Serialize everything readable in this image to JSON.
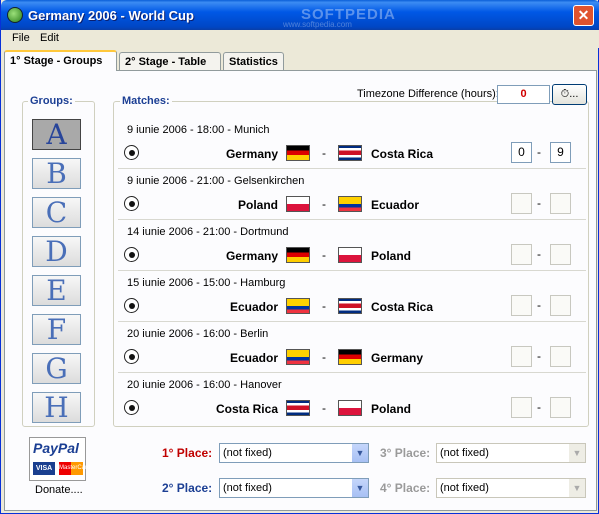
{
  "window": {
    "title": "Germany 2006 - World Cup",
    "watermark": "SOFTPEDIA",
    "watermark_url": "www.softpedia.com",
    "close_glyph": "✕"
  },
  "menu": [
    "File",
    "Edit"
  ],
  "tabs": [
    "1° Stage - Groups",
    "2° Stage - Table",
    "Statistics"
  ],
  "groups": {
    "label": "Groups:",
    "letters": [
      "A",
      "B",
      "C",
      "D",
      "E",
      "F",
      "G",
      "H"
    ],
    "selected": "A"
  },
  "matches": {
    "label": "Matches:",
    "items": [
      {
        "date": "9 iunie 2006 - 18:00 - Munich",
        "team1": "Germany",
        "team2": "Costa Rica",
        "score1": "0",
        "score2": "9"
      },
      {
        "date": "9 iunie 2006 - 21:00 - Gelsenkirchen",
        "team1": "Poland",
        "team2": "Ecuador",
        "score1": "",
        "score2": ""
      },
      {
        "date": "14 iunie 2006 - 21:00 - Dortmund",
        "team1": "Germany",
        "team2": "Poland",
        "score1": "",
        "score2": ""
      },
      {
        "date": "15 iunie 2006 - 15:00 - Hamburg",
        "team1": "Ecuador",
        "team2": "Costa Rica",
        "score1": "",
        "score2": ""
      },
      {
        "date": "20 iunie 2006 - 16:00 - Berlin",
        "team1": "Ecuador",
        "team2": "Germany",
        "score1": "",
        "score2": ""
      },
      {
        "date": "20 iunie 2006 - 16:00 - Hanover",
        "team1": "Costa Rica",
        "team2": "Poland",
        "score1": "",
        "score2": ""
      }
    ]
  },
  "timezone": {
    "label": "Timezone Difference (hours):",
    "value": "0",
    "button": "..."
  },
  "places": [
    {
      "label": "1° Place:",
      "value": "(not fixed)"
    },
    {
      "label": "2° Place:",
      "value": "(not fixed)"
    },
    {
      "label": "3° Place:",
      "value": "(not fixed)"
    },
    {
      "label": "4° Place:",
      "value": "(not fixed)"
    }
  ],
  "paypal": {
    "logo": "PayPal",
    "visa": "VISA",
    "mastercard": "MasterCard",
    "donate": "Donate...."
  },
  "colors": {
    "accent": "#1c3f94",
    "place_red": "#c00000",
    "score_red": "#d00000"
  }
}
